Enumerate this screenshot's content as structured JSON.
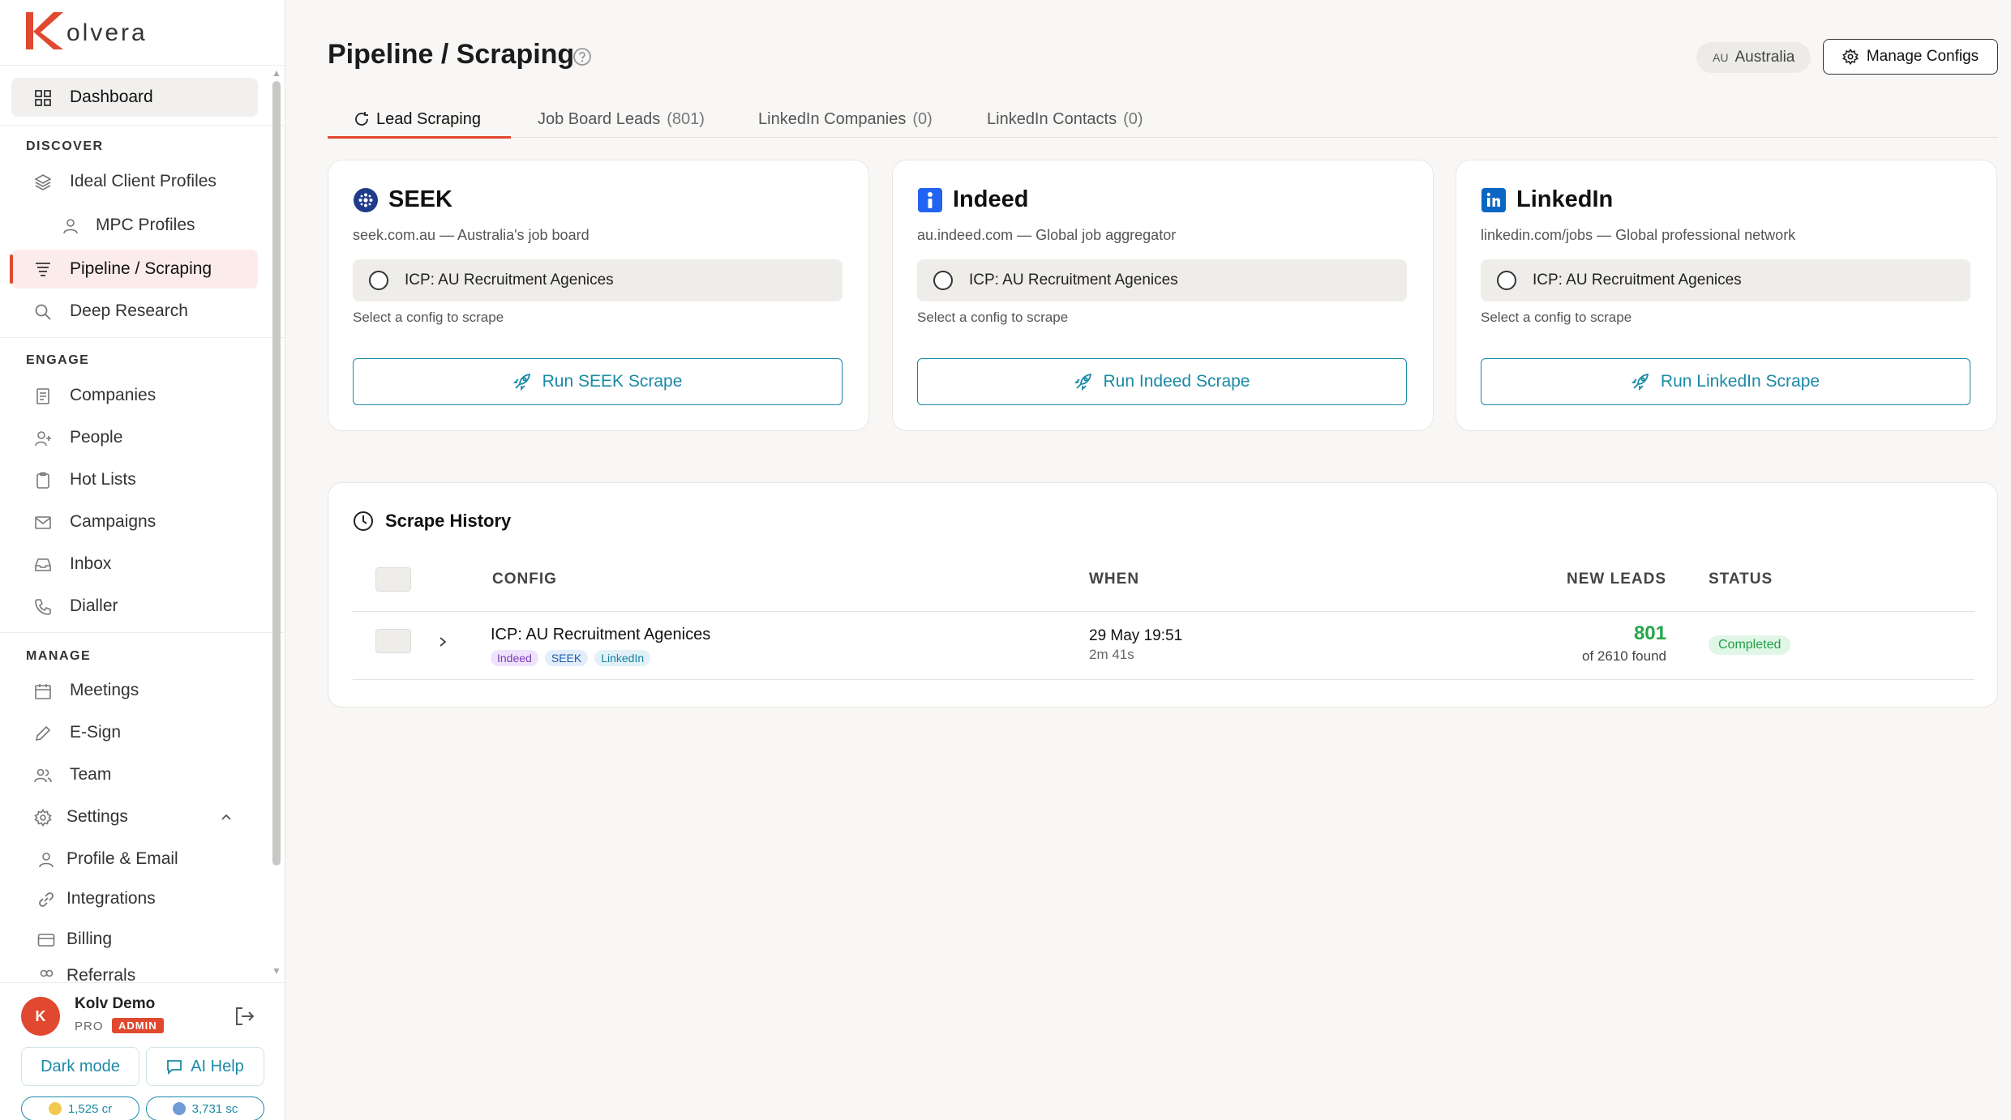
{
  "app": {
    "logo_text": "olvera",
    "logo_letter": "K"
  },
  "sidebar": {
    "dashboard": "Dashboard",
    "sections": {
      "discover": "DISCOVER",
      "engage": "ENGAGE",
      "manage": "MANAGE"
    },
    "discover_items": [
      {
        "label": "Ideal Client Profiles",
        "icon": "layers-icon"
      },
      {
        "label": "MPC Profiles",
        "icon": "person-icon"
      },
      {
        "label": "Pipeline / Scraping",
        "icon": "filter-icon"
      },
      {
        "label": "Deep Research",
        "icon": "search-icon"
      }
    ],
    "engage_items": [
      {
        "label": "Companies",
        "icon": "document-icon"
      },
      {
        "label": "People",
        "icon": "add-person-icon"
      },
      {
        "label": "Hot Lists",
        "icon": "clipboard-icon"
      },
      {
        "label": "Campaigns",
        "icon": "mail-icon"
      },
      {
        "label": "Inbox",
        "icon": "inbox-icon"
      },
      {
        "label": "Dialler",
        "icon": "phone-icon"
      }
    ],
    "manage_items": [
      {
        "label": "Meetings",
        "icon": "calendar-icon"
      },
      {
        "label": "E-Sign",
        "icon": "pen-icon"
      },
      {
        "label": "Team",
        "icon": "team-icon"
      },
      {
        "label": "Settings",
        "icon": "gear-icon"
      },
      {
        "label": "Profile & Email",
        "icon": "person-icon"
      },
      {
        "label": "Integrations",
        "icon": "link-icon"
      },
      {
        "label": "Billing",
        "icon": "card-icon"
      },
      {
        "label": "Referrals",
        "icon": "referrals-icon"
      }
    ],
    "user": {
      "initial": "K",
      "name": "Kolv Demo",
      "plan": "PRO",
      "badge": "ADMIN"
    },
    "buttons": {
      "dark_mode": "Dark mode",
      "ai_help": "AI Help"
    },
    "credits": {
      "cr": "1,525 cr",
      "sc": "3,731 sc",
      "cr_color": "#f2c94c",
      "sc_color": "#6f9bd8"
    }
  },
  "header": {
    "title": "Pipeline / Scraping",
    "country_code": "AU",
    "country": "Australia",
    "manage_configs": "Manage Configs"
  },
  "tabs": [
    {
      "label": "Lead Scraping",
      "count": ""
    },
    {
      "label": "Job Board Leads",
      "count": "(801)"
    },
    {
      "label": "LinkedIn Companies",
      "count": "(0)"
    },
    {
      "label": "LinkedIn Contacts",
      "count": "(0)"
    }
  ],
  "sources": [
    {
      "name": "SEEK",
      "subtitle": "seek.com.au — Australia's job board",
      "config": "ICP: AU Recruitment Agenices",
      "hint": "Select a config to scrape",
      "button": "Run SEEK Scrape",
      "color": "#1f3c8a"
    },
    {
      "name": "Indeed",
      "subtitle": "au.indeed.com — Global job aggregator",
      "config": "ICP: AU Recruitment Agenices",
      "hint": "Select a config to scrape",
      "button": "Run Indeed Scrape",
      "color": "#2164f3"
    },
    {
      "name": "LinkedIn",
      "subtitle": "linkedin.com/jobs — Global professional network",
      "config": "ICP: AU Recruitment Agenices",
      "hint": "Select a config to scrape",
      "button": "Run LinkedIn Scrape",
      "color": "#0a66c2"
    }
  ],
  "history": {
    "title": "Scrape History",
    "columns": {
      "config": "CONFIG",
      "when": "WHEN",
      "new_leads": "NEW LEADS",
      "status": "STATUS"
    },
    "rows": [
      {
        "config": "ICP: AU Recruitment Agenices",
        "chips": [
          "Indeed",
          "SEEK",
          "LinkedIn"
        ],
        "when": "29 May 19:51",
        "duration": "2m 41s",
        "new_leads": "801",
        "found": "of 2610 found",
        "status": "Completed"
      }
    ]
  },
  "colors": {
    "accent": "#e0492f",
    "teal": "#1a8aa6",
    "success": "#22a84a"
  }
}
